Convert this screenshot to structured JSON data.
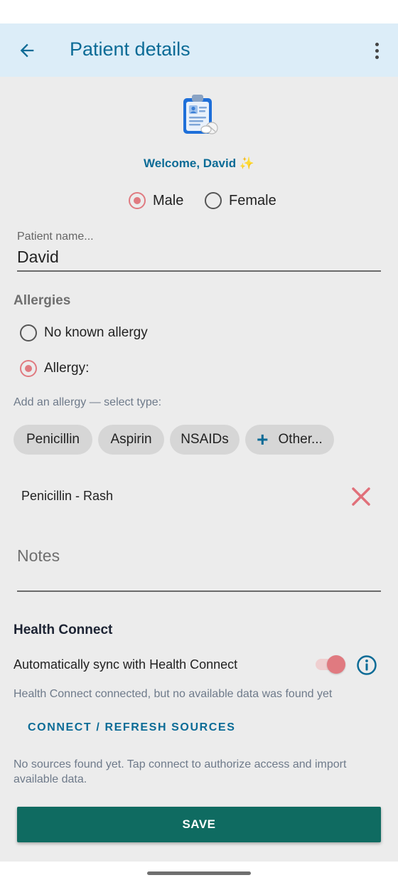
{
  "app_bar": {
    "title": "Patient details"
  },
  "welcome": {
    "text": "Welcome, David ✨"
  },
  "gender": {
    "male_label": "Male",
    "female_label": "Female",
    "selected": "Male"
  },
  "patient_name": {
    "label": "Patient name...",
    "value": "David"
  },
  "allergies": {
    "section_title": "Allergies",
    "no_allergy_label": "No known allergy",
    "allergy_label": "Allergy:",
    "selected": "Allergy:",
    "hint": "Add an allergy — select type:",
    "chips": [
      "Penicillin",
      "Aspirin",
      "NSAIDs",
      "Other..."
    ],
    "entries": [
      {
        "text": "Penicillin - Rash"
      }
    ]
  },
  "notes": {
    "placeholder": "Notes"
  },
  "health_connect": {
    "section_title": "Health Connect",
    "sync_label": "Automatically sync with Health Connect",
    "sync_enabled": true,
    "status_text": "Health Connect connected, but no available data was found yet",
    "connect_button": "CONNECT / REFRESH SOURCES",
    "sources_text": "No sources found yet. Tap connect to authorize access and import available data."
  },
  "save_button": "SAVE",
  "colors": {
    "accent": "#0b6b96",
    "selection": "#e07a80",
    "save": "#0f6b61",
    "app_bar_bg": "#dcedf8",
    "content_bg": "#ececec"
  }
}
